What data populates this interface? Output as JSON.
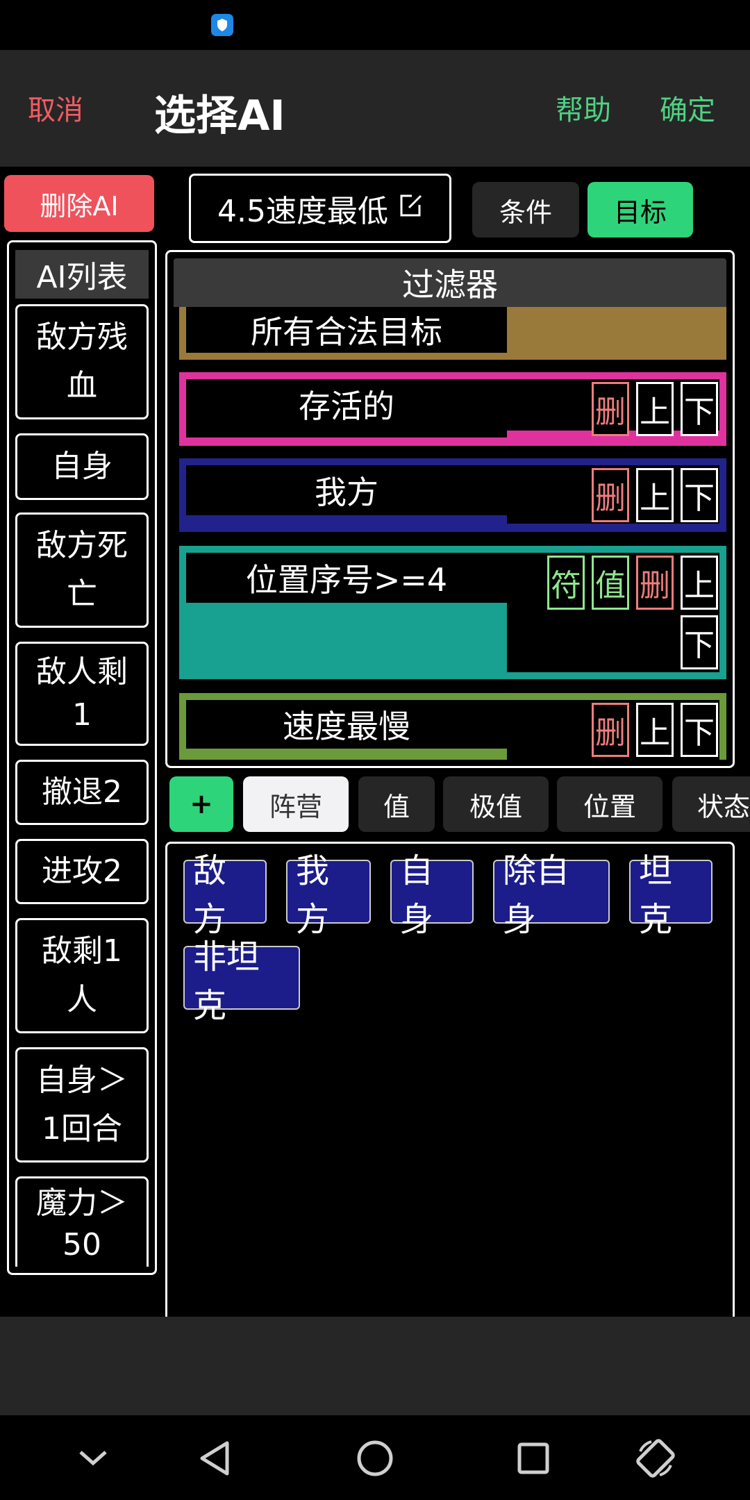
{
  "header": {
    "cancel_label": "取消",
    "title": "选择AI",
    "help_label": "帮助",
    "confirm_label": "确定"
  },
  "toolbar": {
    "delete_ai_label": "删除AI",
    "ai_name": "4.5速度最低",
    "tab_condition": "条件",
    "tab_target": "目标"
  },
  "ai_list": {
    "title": "AI列表",
    "items": [
      "敌方残血",
      "自身",
      "敌方死亡",
      "敌人剩1",
      "撤退2",
      "进攻2",
      "敌剩1人",
      "自身＞1回合",
      "魔力＞50"
    ]
  },
  "filter": {
    "title": "过滤器",
    "rows": [
      {
        "label": "所有合法目标",
        "color": "#9a7a3a"
      },
      {
        "label": "存活的",
        "color": "#e0329f",
        "delete": "删",
        "up": "上",
        "down": "下"
      },
      {
        "label": "我方",
        "color": "#22228c",
        "delete": "删",
        "up": "上",
        "down": "下"
      },
      {
        "label": "位置序号>=4",
        "color": "#18a090",
        "symbol": "符",
        "value": "值",
        "delete": "删",
        "up": "上",
        "down": "下"
      },
      {
        "label": "速度最慢",
        "color": "#6a9a3a",
        "delete": "删",
        "up": "上",
        "down": "下"
      }
    ]
  },
  "category_tabs": {
    "add_label": "+",
    "tabs": [
      "阵营",
      "值",
      "极值",
      "位置",
      "状态"
    ]
  },
  "options": [
    "敌方",
    "我方",
    "自身",
    "除自身",
    "坦克",
    "非坦克"
  ],
  "colors": {
    "accent_green": "#2ed47a",
    "cancel_red": "#f25c63",
    "delete_red": "#f0525c",
    "option_blue": "#1c1c8a",
    "status_shield": "#1e88e5"
  },
  "icons": [
    "shield-icon",
    "edit-icon",
    "chevron-down-icon",
    "back-icon",
    "home-icon",
    "recents-icon",
    "rotate-icon"
  ]
}
